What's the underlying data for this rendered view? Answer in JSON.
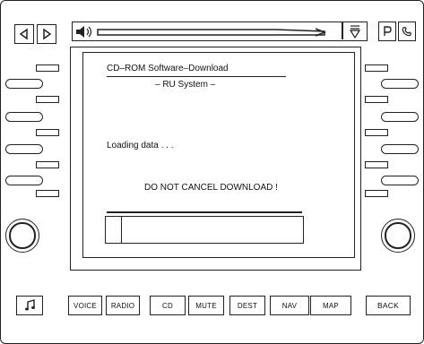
{
  "top_bar": {
    "left_icons": [
      "skip-back-icon",
      "skip-forward-icon"
    ],
    "speaker_icon": "speaker-icon",
    "tone_icon": "tone-adjust-icon",
    "right_icons": [
      "park-assist-icon",
      "phone-icon"
    ]
  },
  "screen": {
    "title": "CD–ROM  Software–Download",
    "subtitle": "– RU System –",
    "status": "Loading data . . .",
    "warning": "DO NOT CANCEL DOWNLOAD !",
    "progress": 0.08
  },
  "bottom_bar": {
    "music_icon": "music-note-icon",
    "voice": "VOICE",
    "radio": "RADIO",
    "cd": "CD",
    "mute": "MUTE",
    "dest": "DEST",
    "nav": "NAV",
    "map": "MAP",
    "back": "BACK"
  }
}
